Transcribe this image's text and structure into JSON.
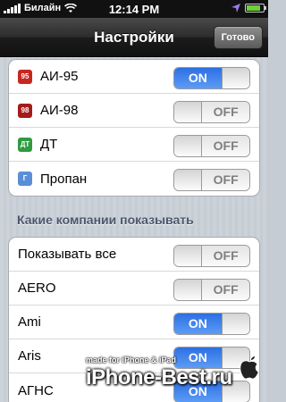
{
  "status_bar": {
    "carrier": "Билайн",
    "time": "12:14 PM"
  },
  "nav": {
    "title": "Настройки",
    "done_label": "Готово"
  },
  "fuel_types": [
    {
      "icon_text": "95",
      "icon_color": "#c8261f",
      "label": "АИ-95",
      "on": true,
      "on_label": "ON",
      "off_label": "OFF"
    },
    {
      "icon_text": "98",
      "icon_color": "#a51b1b",
      "label": "АИ-98",
      "on": false,
      "on_label": "ON",
      "off_label": "OFF"
    },
    {
      "icon_text": "ДТ",
      "icon_color": "#2e9b3f",
      "label": "ДТ",
      "on": false,
      "on_label": "ON",
      "off_label": "OFF"
    },
    {
      "icon_text": "Г",
      "icon_color": "#5a8fd8",
      "label": "Пропан",
      "on": false,
      "on_label": "ON",
      "off_label": "OFF"
    }
  ],
  "companies_section": {
    "header": "Какие компании показывать",
    "items": [
      {
        "label": "Показывать все",
        "on": false,
        "on_label": "ON",
        "off_label": "OFF"
      },
      {
        "label": "AERO",
        "on": false,
        "on_label": "ON",
        "off_label": "OFF"
      },
      {
        "label": "Ami",
        "on": true,
        "on_label": "ON",
        "off_label": "OFF"
      },
      {
        "label": "Aris",
        "on": true,
        "on_label": "ON",
        "off_label": "OFF"
      },
      {
        "label": "АГНС",
        "on": true,
        "on_label": "ON",
        "off_label": "OFF"
      }
    ]
  },
  "watermark": {
    "small": "made for iPhone & iPad",
    "big": "iPhone-Best.ru"
  },
  "colors": {
    "toggle_on": "#3a7fe8",
    "nav_bg": "#2c2c2c",
    "section_header": "#4c566c"
  }
}
